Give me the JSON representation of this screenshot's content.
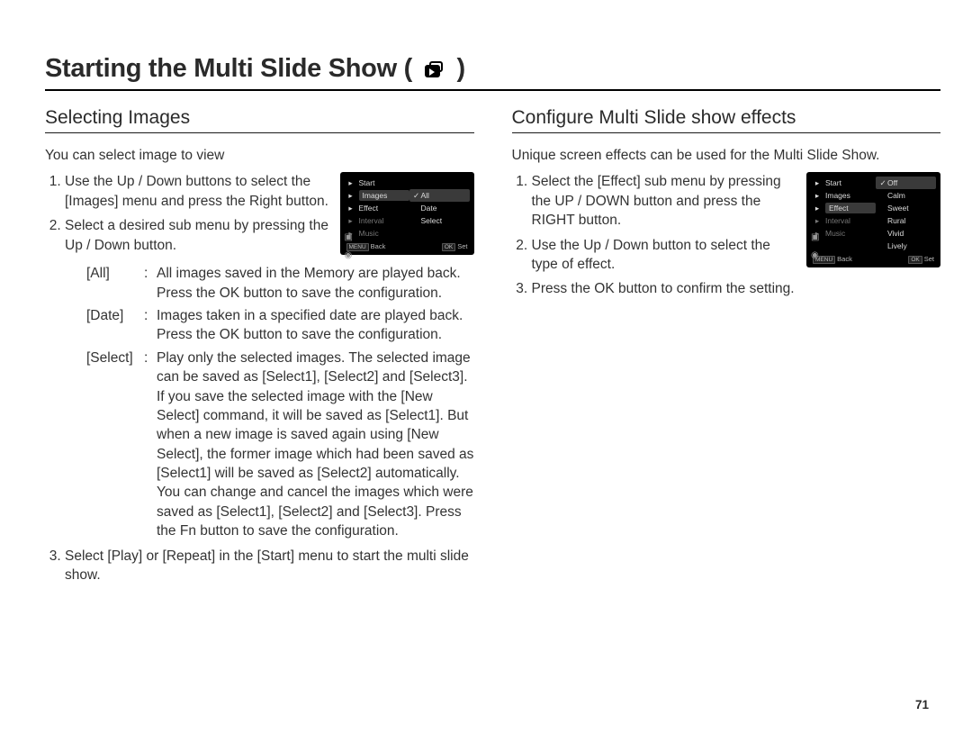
{
  "page_number": "71",
  "title_pre": "Starting the Multi Slide Show (",
  "title_post": ")",
  "left": {
    "heading": "Selecting Images",
    "intro": "You can select image to view",
    "step1": "Use the Up / Down buttons to select the [Images] menu and press the Right button.",
    "step2": "Select a desired sub menu by pressing the Up / Down button.",
    "opts": {
      "all_k": "[All]",
      "all_d": "All images saved in the Memory are played back.\nPress the OK button to save the configuration.",
      "date_k": "[Date]",
      "date_d": "Images taken in a specified date are played back.\nPress the OK button to save the configuration.",
      "select_k": "[Select]",
      "select_d": "Play only the selected images.\nThe selected image can be saved as [Select1], [Select2] and [Select3]. If you save the selected image with the [New Select] command, it will be saved as [Select1]. But when a new image is saved again using [New Select], the former image which had been saved as [Select1] will be saved as [Select2] automatically. You can change and cancel the images which were saved as [Select1], [Select2] and [Select3]. Press the Fn button to save the configuration."
    },
    "step3": "Select [Play] or [Repeat] in the [Start] menu to start the multi slide show.",
    "colon": ":"
  },
  "right": {
    "heading": "Configure Multi Slide show effects",
    "intro": "Unique screen effects can be used for the Multi Slide Show.",
    "step1": "Select the [Effect] sub menu by pressing the UP / DOWN button and press the RIGHT button.",
    "step2": "Use the Up / Down button to select the type of effect.",
    "step3": "Press the OK button to confirm the setting."
  },
  "cam_menu": {
    "items": [
      "Start",
      "Images",
      "Effect",
      "Interval",
      "Music"
    ],
    "right_images": [
      "All",
      "Date",
      "Select"
    ],
    "right_effects": [
      "Off",
      "Calm",
      "Sweet",
      "Rural",
      "Vivid",
      "Lively"
    ],
    "footer_back": "Back",
    "footer_set": "Set",
    "tag_menu": "MENU",
    "tag_ok": "OK"
  }
}
